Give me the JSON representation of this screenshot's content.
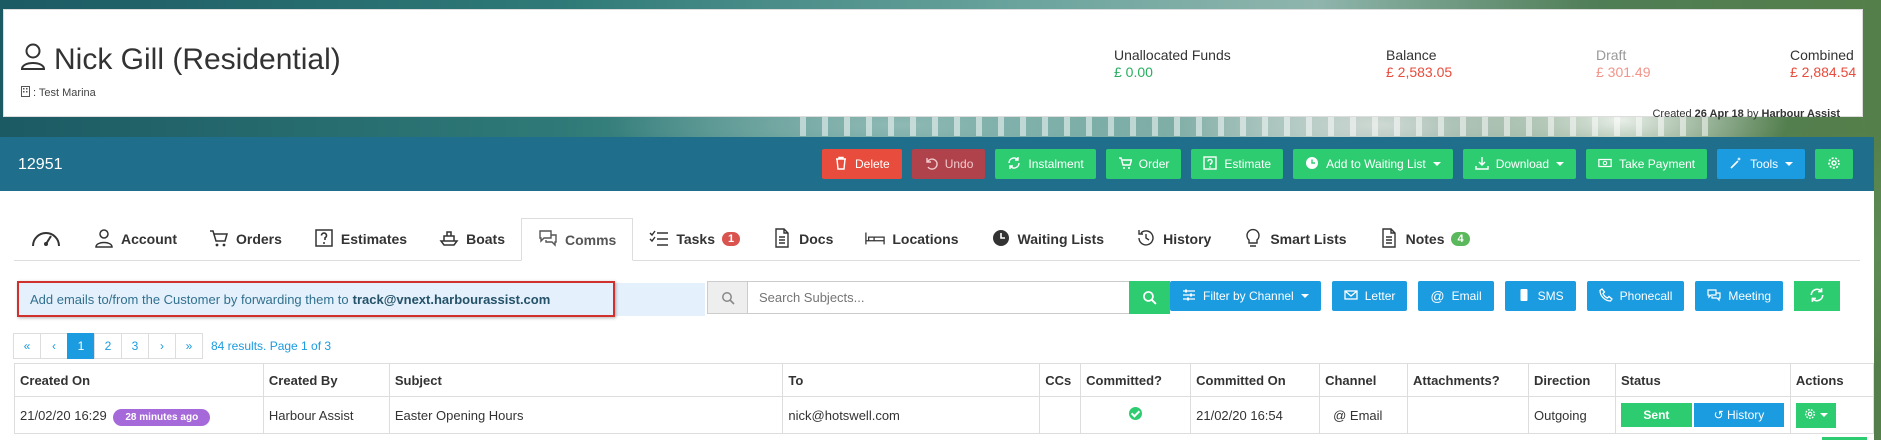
{
  "customer": {
    "name": "Nick Gill (Residential)",
    "marina": ": Test Marina"
  },
  "finance": {
    "unallocated_label": "Unallocated Funds",
    "unallocated_value": "£ 0.00",
    "balance_label": "Balance",
    "balance_value": "£ 2,583.05",
    "draft_label": "Draft",
    "draft_value": "£ 301.49",
    "combined_label": "Combined",
    "combined_value": "£ 2,884.54"
  },
  "created": {
    "prefix": "Created",
    "date": "26 Apr 18",
    "by": "by",
    "author": "Harbour Assist"
  },
  "record_id": "12951",
  "toolbar": {
    "delete": "Delete",
    "undo": "Undo",
    "instalment": "Instalment",
    "order": "Order",
    "estimate": "Estimate",
    "waiting_list": "Add to Waiting List",
    "download": "Download",
    "take_payment": "Take Payment",
    "tools": "Tools"
  },
  "tabs": {
    "account": "Account",
    "orders": "Orders",
    "estimates": "Estimates",
    "boats": "Boats",
    "comms": "Comms",
    "tasks": "Tasks",
    "tasks_count": "1",
    "docs": "Docs",
    "locations": "Locations",
    "waiting_lists": "Waiting Lists",
    "history": "History",
    "smart_lists": "Smart Lists",
    "notes": "Notes",
    "notes_count": "4"
  },
  "info": {
    "text": "Add emails to/from the Customer by forwarding them to",
    "email": "track@vnext.harbourassist.com"
  },
  "search": {
    "placeholder": "Search Subjects..."
  },
  "channel_bar": {
    "filter": "Filter by Channel",
    "letter": "Letter",
    "email": "Email",
    "sms": "SMS",
    "phonecall": "Phonecall",
    "meeting": "Meeting"
  },
  "pager": {
    "first": "«",
    "prev": "‹",
    "p1": "1",
    "p2": "2",
    "p3": "3",
    "next": "›",
    "last": "»",
    "info": "84 results. Page 1 of 3"
  },
  "table": {
    "headers": [
      "Created On",
      "Created By",
      "Subject",
      "To",
      "CCs",
      "Committed?",
      "Committed On",
      "Channel",
      "Attachments?",
      "Direction",
      "Status",
      "Actions"
    ],
    "rows": [
      {
        "created_on": "21/02/20 16:29",
        "ago": "28 minutes ago",
        "created_by": "Harbour Assist",
        "subject": "Easter Opening Hours",
        "to": "nick@hotswell.com",
        "ccs": "",
        "committed_on": "21/02/20 16:54",
        "channel": "Email",
        "attachments": "",
        "direction": "Outgoing",
        "status": "Sent",
        "history": "History"
      }
    ]
  },
  "colors": {
    "bluebar": "#1f6e8c",
    "green": "#2ecc71",
    "blue": "#1b9be0",
    "red": "#e74c3c"
  }
}
